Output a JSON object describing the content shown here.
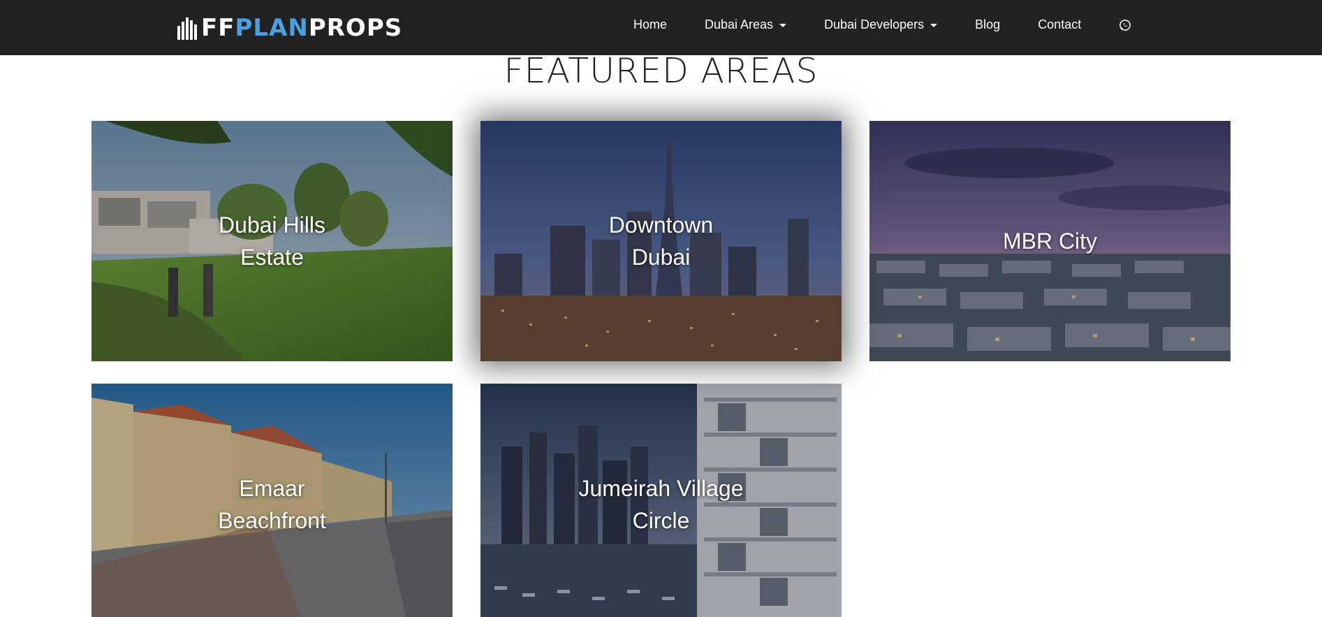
{
  "brand": {
    "name_part1": "FF",
    "name_part2": "PLAN",
    "name_part3": "PROPS",
    "accent_color": "#4a9fe0",
    "logo_icon": "building-columns-logo-icon"
  },
  "nav": {
    "items": [
      {
        "label": "Home",
        "dropdown": false
      },
      {
        "label": "Dubai Areas",
        "dropdown": true
      },
      {
        "label": "Dubai Developers",
        "dropdown": true
      },
      {
        "label": "Blog",
        "dropdown": false
      },
      {
        "label": "Contact",
        "dropdown": false
      }
    ],
    "whatsapp_icon": "whatsapp-icon"
  },
  "section": {
    "title": "FEATURED AREAS"
  },
  "areas": [
    {
      "name": "Dubai Hills Estate",
      "image": "golf-course-villas"
    },
    {
      "name": "Downtown Dubai",
      "image": "burj-khalifa-night-skyline"
    },
    {
      "name": "MBR City",
      "image": "villa-community-dusk"
    },
    {
      "name": "Emaar Beachfront",
      "image": "townhouses-street"
    },
    {
      "name": "Jumeirah Village Circle",
      "image": "marina-skyline-balconies"
    }
  ]
}
